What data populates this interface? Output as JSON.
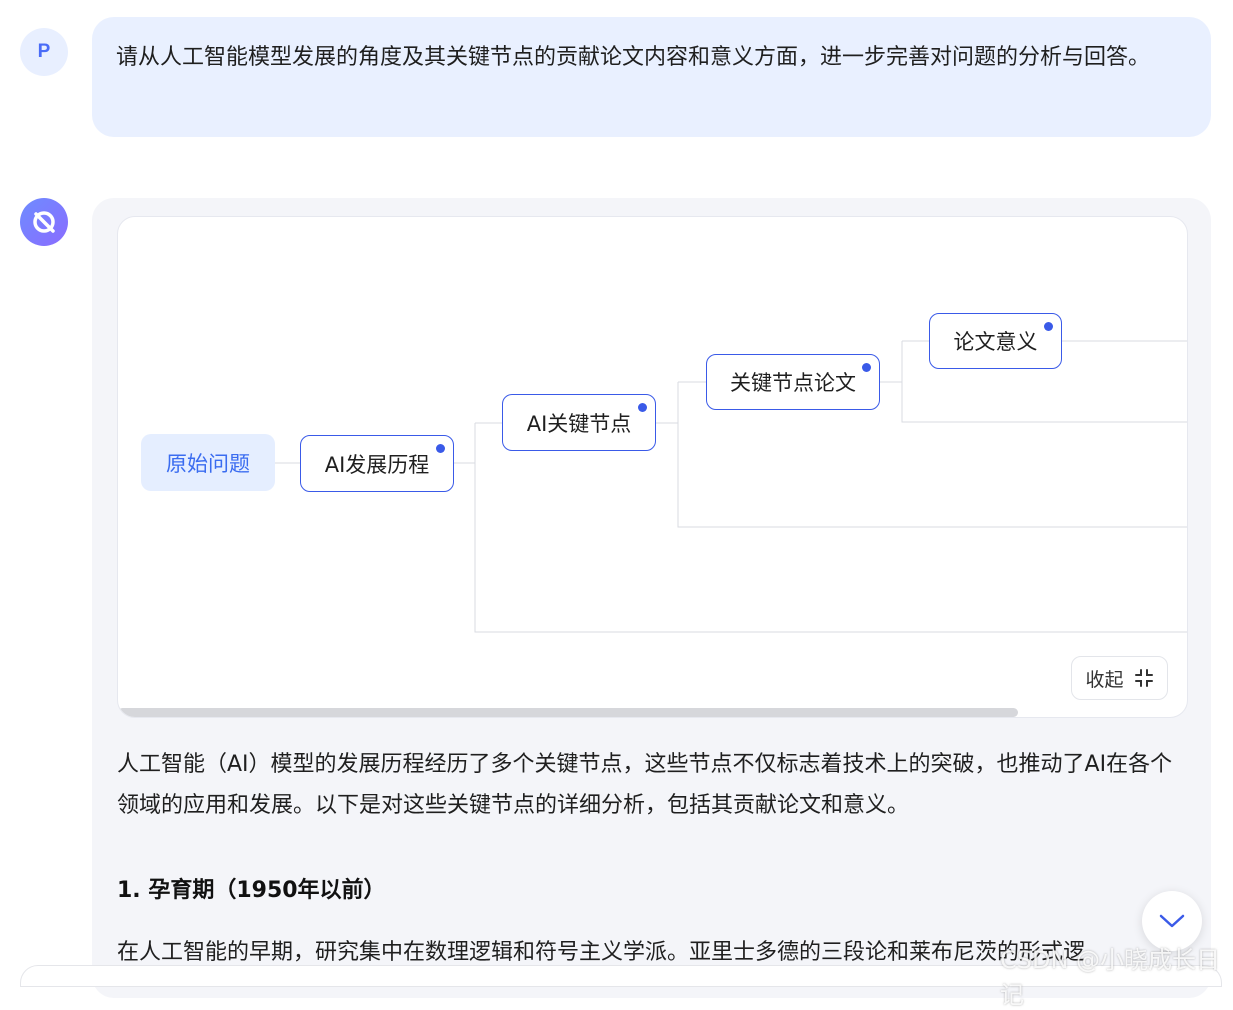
{
  "user": {
    "avatar_letter": "P",
    "message": "请从人工智能模型发展的角度及其关键节点的贡献论文内容和意义方面，进一步完善对问题的分析与回答。"
  },
  "mindmap": {
    "root": "原始问题",
    "level1": "AI发展历程",
    "level2": "AI关键节点",
    "level3": "关键节点论文",
    "level4": "论文意义",
    "collapse_label": "收起"
  },
  "answer": {
    "intro": "人工智能（AI）模型的发展历程经历了多个关键节点，这些节点不仅标志着技术上的突破，也推动了AI在各个领域的应用和发展。以下是对这些关键节点的详细分析，包括其贡献论文和意义。",
    "section1_title": "1. 孕育期（1950年以前）",
    "section1_text": "在人工智能的早期，研究集中在数理逻辑和符号主义学派。亚里士多德的三段论和莱布尼茨的形式逻"
  },
  "watermark": "CSDN @小晓成长日记",
  "colors": {
    "accent": "#3a5ae8",
    "user_bubble": "#e9f0ff",
    "panel": "#f4f5f9"
  }
}
